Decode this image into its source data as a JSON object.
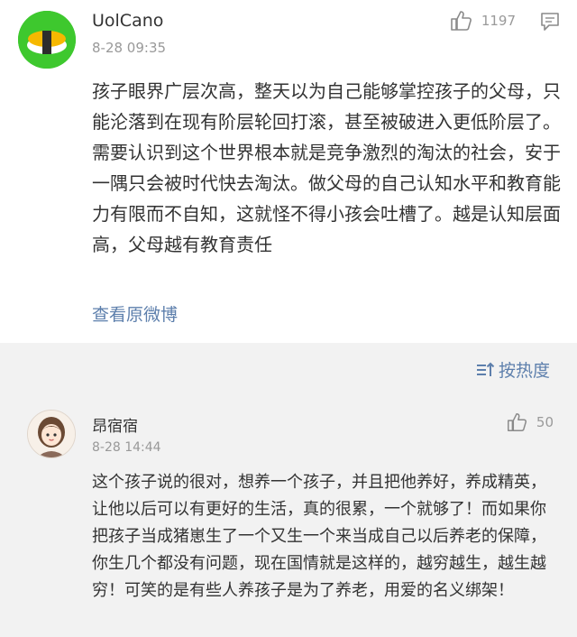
{
  "post": {
    "username": "UolCano",
    "time": "8-28 09:35",
    "like_count": "1197",
    "body": "孩子眼界广层次高，整天以为自己能够掌控孩子的父母，只能沦落到在现有阶层轮回打滚，甚至被破进入更低阶层了。需要认识到这个世界根本就是竞争激烈的淘汰的社会，安于一隅只会被时代快去淘汰。做父母的自己认知水平和教育能力有限而不自知，这就怪不得小孩会吐槽了。越是认知层面高，父母越有教育责任",
    "view_original": "查看原微博",
    "icons": {
      "like": "thumbs-up-icon",
      "comment": "comment-icon"
    }
  },
  "sort": {
    "label": "按热度",
    "icon": "sort-icon"
  },
  "reply": {
    "username": "昂宿宿",
    "time": "8-28 14:44",
    "like_count": "50",
    "body": "这个孩子说的很对，想养一个孩子，并且把他养好，养成精英，让他以后可以有更好的生活，真的很累，一个就够了！而如果你把孩子当成猪崽生了一个又生一个来当成自己以后养老的保障，你生几个都没有问题，现在国情就是这样的，越穷越生，越生越穷！可笑的是有些人养孩子是为了养老，用爱的名义绑架！"
  },
  "colors": {
    "link": "#5d7fac",
    "avatar_green": "#3ec82e",
    "muted": "#999999",
    "section_bg": "#f2f2f2"
  }
}
